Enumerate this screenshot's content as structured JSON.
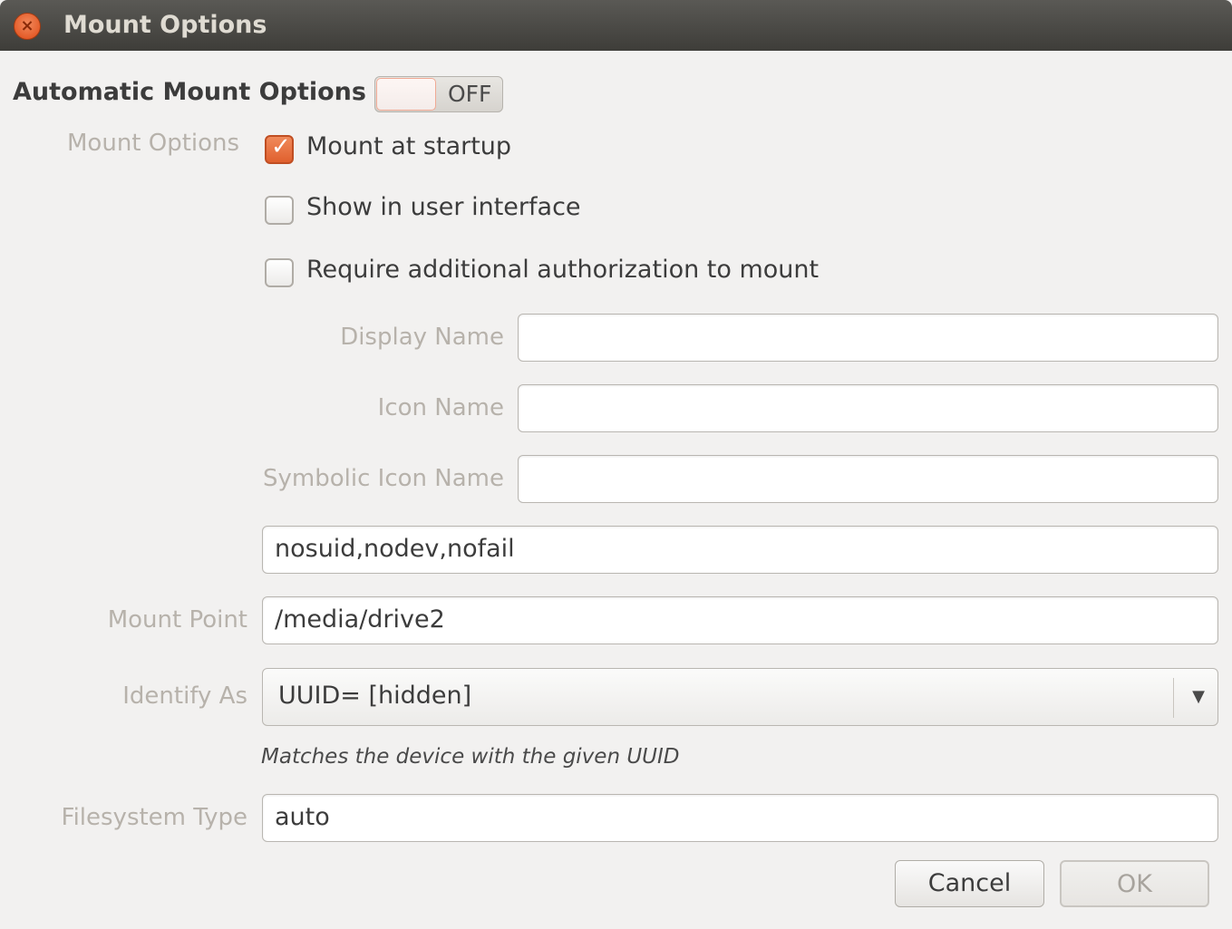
{
  "window": {
    "title": "Mount Options",
    "close_icon": "close-icon"
  },
  "automatic": {
    "label": "Automatic Mount Options",
    "switch_state": "OFF"
  },
  "mount_options": {
    "label": "Mount Options",
    "checkboxes": [
      {
        "label": "Mount at startup",
        "checked": true
      },
      {
        "label": "Show in user interface",
        "checked": false
      },
      {
        "label": "Require additional authorization to mount",
        "checked": false
      }
    ]
  },
  "fields": {
    "display_name": {
      "label": "Display Name",
      "value": ""
    },
    "icon_name": {
      "label": "Icon Name",
      "value": ""
    },
    "symbolic_icon_name": {
      "label": "Symbolic Icon Name",
      "value": ""
    },
    "options_value": "nosuid,nodev,nofail",
    "mount_point": {
      "label": "Mount Point",
      "value": "/media/drive2"
    },
    "identify_as": {
      "label": "Identify As",
      "value": "UUID= [hidden]",
      "hint": "Matches the device with the given UUID"
    },
    "filesystem_type": {
      "label": "Filesystem Type",
      "value": "auto"
    }
  },
  "buttons": {
    "cancel": "Cancel",
    "ok": "OK"
  },
  "colors": {
    "accent": "#e0602e",
    "titlebar": "#3e3d39",
    "background": "#f2f1f0"
  }
}
